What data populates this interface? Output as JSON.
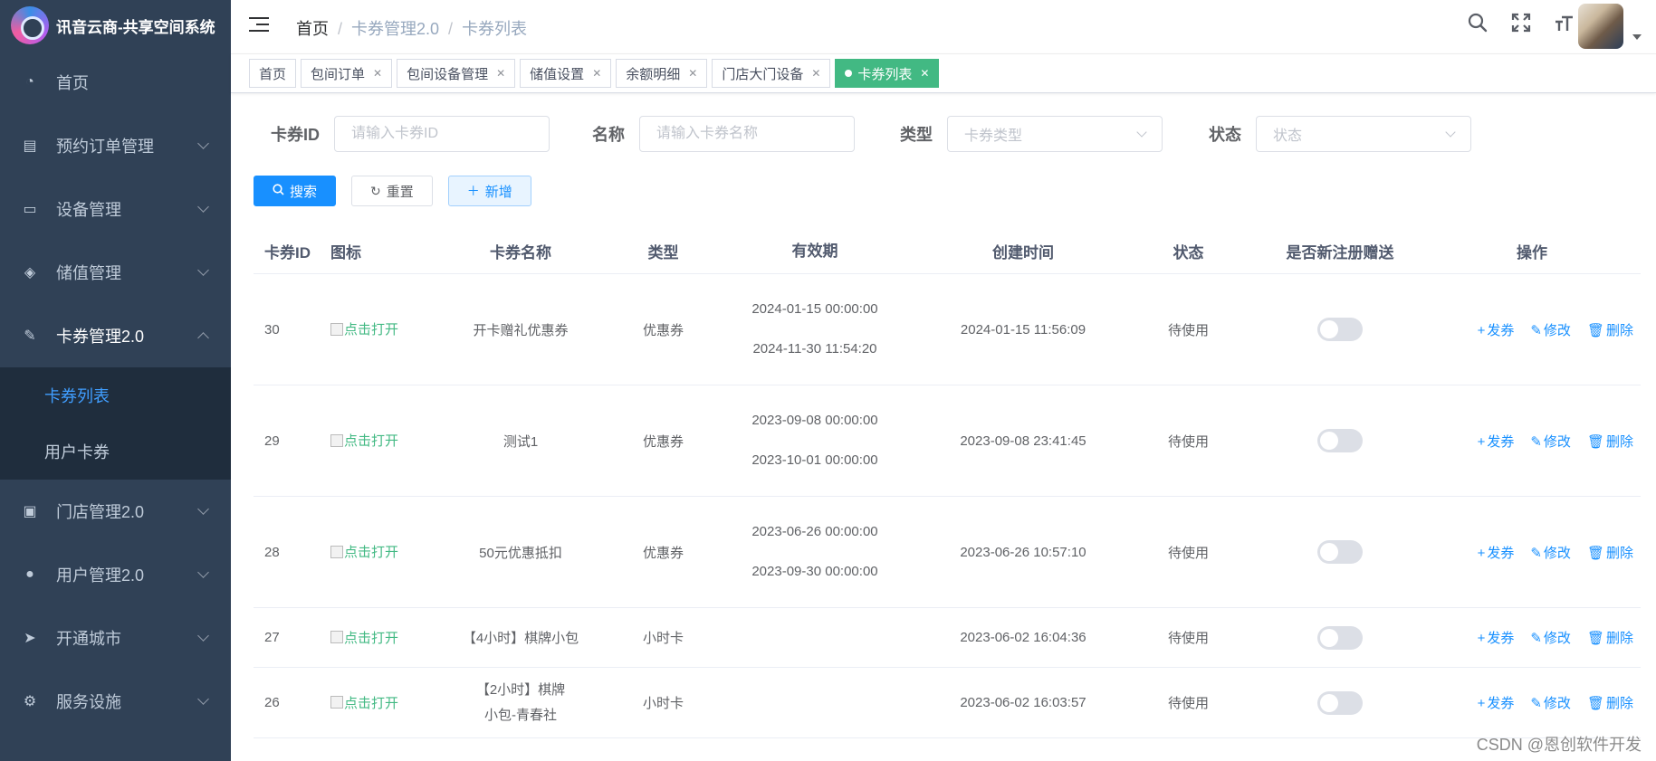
{
  "app": {
    "title": "讯音云商-共享空间系统"
  },
  "sidebar": {
    "items": [
      {
        "label": "首页",
        "icon": "dashboard-icon"
      },
      {
        "label": "预约订单管理",
        "icon": "document-icon"
      },
      {
        "label": "设备管理",
        "icon": "monitor-icon"
      },
      {
        "label": "储值管理",
        "icon": "money-icon"
      },
      {
        "label": "卡券管理2.0",
        "icon": "coupon-icon"
      },
      {
        "label": "门店管理2.0",
        "icon": "shop-icon"
      },
      {
        "label": "用户管理2.0",
        "icon": "user-icon"
      },
      {
        "label": "开通城市",
        "icon": "send-icon"
      },
      {
        "label": "服务设施",
        "icon": "gear-icon"
      }
    ],
    "submenu": [
      {
        "label": "卡券列表",
        "active": true
      },
      {
        "label": "用户卡券",
        "active": false
      }
    ]
  },
  "header": {
    "breadcrumb": [
      "首页",
      "卡券管理2.0",
      "卡券列表"
    ]
  },
  "tags": [
    {
      "label": "首页",
      "closable": false
    },
    {
      "label": "包间订单",
      "closable": true
    },
    {
      "label": "包间设备管理",
      "closable": true
    },
    {
      "label": "储值设置",
      "closable": true
    },
    {
      "label": "余额明细",
      "closable": true
    },
    {
      "label": "门店大门设备",
      "closable": true
    },
    {
      "label": "卡券列表",
      "closable": true,
      "active": true
    }
  ],
  "search": {
    "id_label": "卡券ID",
    "id_placeholder": "请输入卡券ID",
    "name_label": "名称",
    "name_placeholder": "请输入卡券名称",
    "type_label": "类型",
    "type_placeholder": "卡券类型",
    "status_label": "状态",
    "status_placeholder": "状态",
    "search_btn": "搜索",
    "reset_btn": "重置",
    "add_btn": "新增"
  },
  "table": {
    "columns": [
      "卡券ID",
      "图标",
      "卡券名称",
      "类型",
      "有效期",
      "创建时间",
      "状态",
      "是否新注册赠送",
      "操作"
    ],
    "image_alt": "点击打开",
    "actions": {
      "issue": "发券",
      "edit": "修改",
      "delete": "删除"
    },
    "rows": [
      {
        "id": "30",
        "name": "开卡赠礼优惠券",
        "type": "优惠券",
        "valid_from": "2024-01-15 00:00:00",
        "valid_to": "2024-11-30 11:54:20",
        "created": "2024-01-15 11:56:09",
        "status": "待使用",
        "register_gift": false
      },
      {
        "id": "29",
        "name": "测试1",
        "type": "优惠券",
        "valid_from": "2023-09-08 00:00:00",
        "valid_to": "2023-10-01 00:00:00",
        "created": "2023-09-08 23:41:45",
        "status": "待使用",
        "register_gift": false
      },
      {
        "id": "28",
        "name": "50元优惠抵扣",
        "type": "优惠券",
        "valid_from": "2023-06-26 00:00:00",
        "valid_to": "2023-09-30 00:00:00",
        "created": "2023-06-26 10:57:10",
        "status": "待使用",
        "register_gift": false
      },
      {
        "id": "27",
        "name": "【4小时】棋牌小包",
        "type": "小时卡",
        "valid_from": "",
        "valid_to": "",
        "created": "2023-06-02 16:04:36",
        "status": "待使用",
        "register_gift": false
      },
      {
        "id": "26",
        "name": "【2小时】棋牌小包-青春社",
        "type": "小时卡",
        "valid_from": "",
        "valid_to": "",
        "created": "2023-06-02 16:03:57",
        "status": "待使用",
        "register_gift": false
      }
    ]
  },
  "watermark": "CSDN @恩创软件开发"
}
